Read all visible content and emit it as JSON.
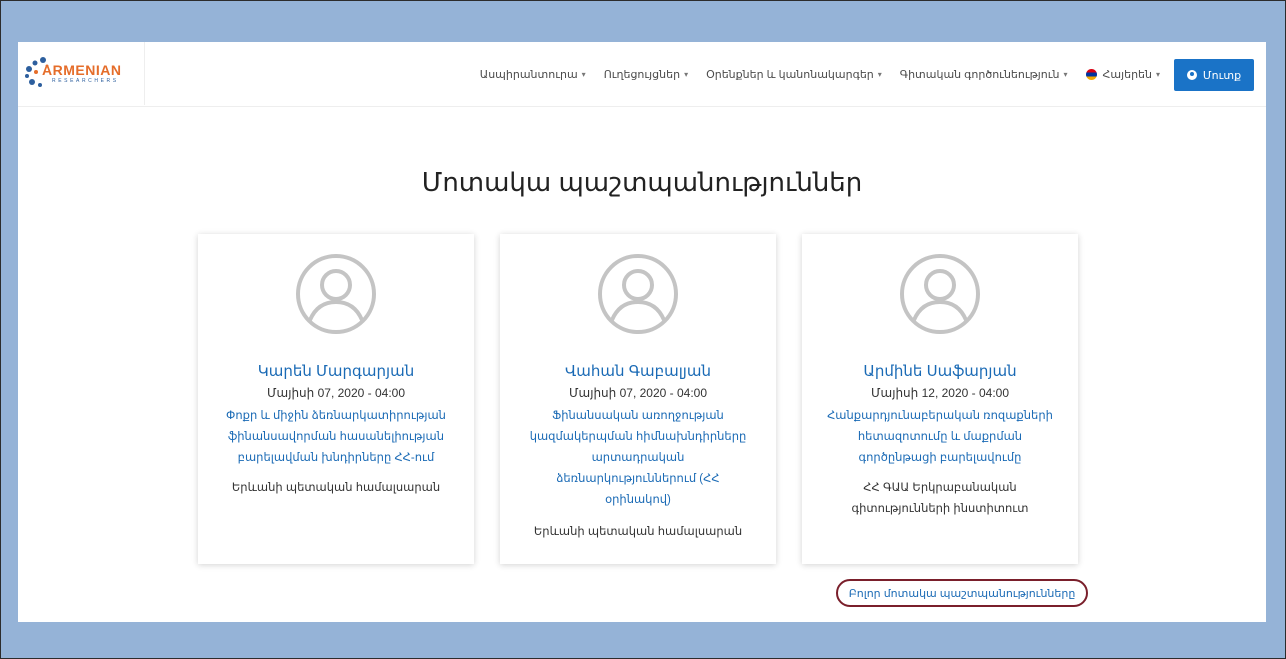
{
  "header": {
    "logo_text": "ARMENIAN",
    "logo_sub": "RESEARCHERS",
    "nav": [
      {
        "label": "Ասպիրանտուրա"
      },
      {
        "label": "Ուղեցույցներ"
      },
      {
        "label": "Օրենքներ և կանոնակարգեր"
      },
      {
        "label": "Գիտական գործունեություն"
      },
      {
        "label": "Հայերեն"
      }
    ],
    "login_label": "Մուտք"
  },
  "main": {
    "title": "Մոտակա պաշտպանություններ",
    "cards": [
      {
        "name": "Կարեն Մարգարյան",
        "date": "Մայիսի 07, 2020 - 04:00",
        "topic": "Փոքր և միջին ձեռնարկատիրության ֆինանսավորման հասանելիության բարելավման խնդիրները ՀՀ-ում",
        "org": "Երևանի պետական համալսարան"
      },
      {
        "name": "Վահան Գաբալյան",
        "date": "Մայիսի 07, 2020 - 04:00",
        "topic": "Ֆինանսական առողջության կազմակերպման հիմնախնդիրները արտադրական ձեռնարկություններում (ՀՀ օրինակով)",
        "org": "Երևանի պետական համալսարան"
      },
      {
        "name": "Արմինե Սաֆարյան",
        "date": "Մայիսի 12, 2020 - 04:00",
        "topic": "Հանքարդյունաբերական ռոզաքների հետազոտումը և մաքրման գործընթացի բարելավումը",
        "org": "ՀՀ ԳԱԱ Երկրաբանական գիտությունների ինստիտուտ"
      }
    ],
    "all_link": "Բոլոր մոտակա պաշտպանությունները"
  },
  "colors": {
    "background": "#95b3d7",
    "accent": "#1a73c7",
    "link": "#1a6ab5",
    "highlight_border": "#7a1f2b"
  },
  "icons": {
    "logo": "armenian-researchers-logo",
    "avatar": "default-user-avatar-icon",
    "login": "user-circle-icon",
    "flag": "armenian-flag-icon"
  }
}
